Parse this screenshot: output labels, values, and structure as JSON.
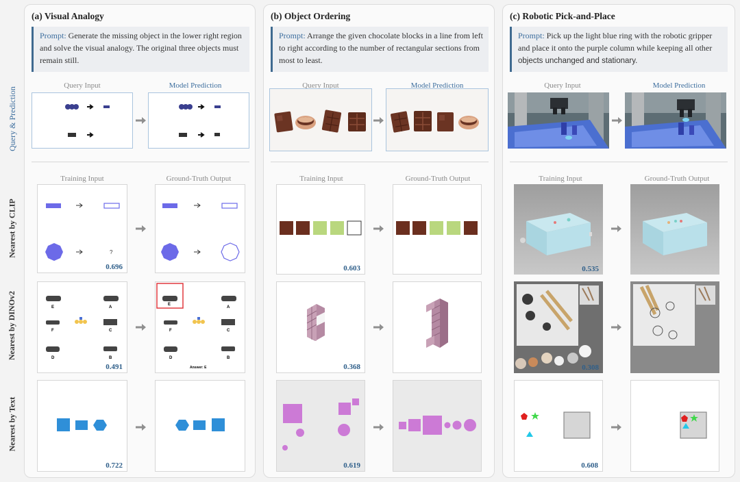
{
  "row_labels": {
    "query": "Query & Prediction",
    "clip": "Nearest by CLIP",
    "dino": "Nearest by DINOv2",
    "text": "Nearest by Text"
  },
  "col_labels": {
    "query_input": "Query Input",
    "model_prediction": "Model Prediction",
    "training_input": "Training Input",
    "ground_truth": "Ground-Truth Output"
  },
  "prompt_label": "Prompt:",
  "panels": [
    {
      "title": "(a) Visual Analogy",
      "prompt": "Generate the missing object in the lower right region and solve the visual analogy. The original three objects must remain still.",
      "scores": {
        "clip": "0.696",
        "dino": "0.491",
        "text": "0.722"
      },
      "dino_letters": [
        "E",
        "A",
        "F",
        "C",
        "D",
        "B"
      ],
      "dino_answer": "Answer: E",
      "clip_question": "?"
    },
    {
      "title": "(b) Object Ordering",
      "prompt": "Arrange the given chocolate blocks in a line from left to right according to the number of rectangular sections from most to least.",
      "scores": {
        "clip": "0.603",
        "dino": "0.368",
        "text": "0.619"
      }
    },
    {
      "title": "(c) Robotic Pick-and-Place",
      "prompt_serif": "Pick up the light blue ring with the robotic gripper and place it onto the purple column while keeping all other ",
      "prompt_sans": "objects unchanged and stationary.",
      "scores": {
        "clip": "0.535",
        "dino": "0.308",
        "text": "0.608"
      }
    }
  ],
  "colors": {
    "accent": "#3d6e9e",
    "score": "#2f5f8a",
    "highlight_box": "#e0393e"
  }
}
